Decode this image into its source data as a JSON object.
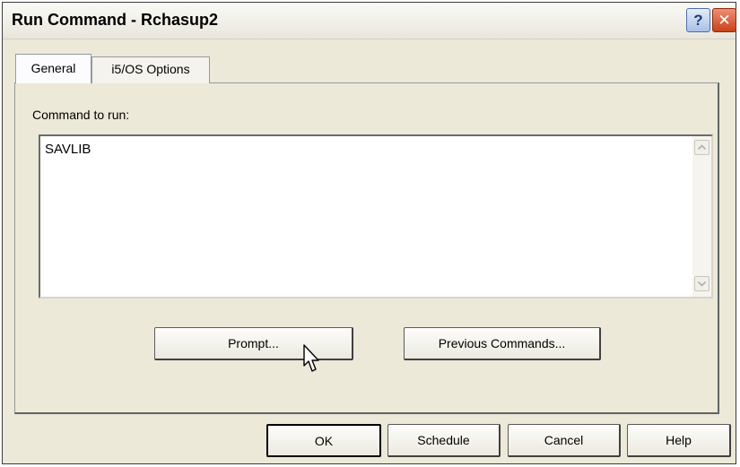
{
  "window": {
    "title": "Run Command - Rchasup2",
    "help_glyph": "?",
    "close_glyph": "✕"
  },
  "tabs": [
    {
      "label": "General",
      "selected": true
    },
    {
      "label": "i5/OS Options",
      "selected": false
    }
  ],
  "general": {
    "command_label": "Command to run:",
    "command_value": "SAVLIB",
    "prompt_label": "Prompt...",
    "previous_label": "Previous Commands..."
  },
  "footer": {
    "ok_label": "OK",
    "schedule_label": "Schedule",
    "cancel_label": "Cancel",
    "help_label": "Help"
  },
  "icons": {
    "scroll_up": "chevron-up-icon",
    "scroll_down": "chevron-down-icon",
    "cursor": "mouse-pointer-icon"
  }
}
